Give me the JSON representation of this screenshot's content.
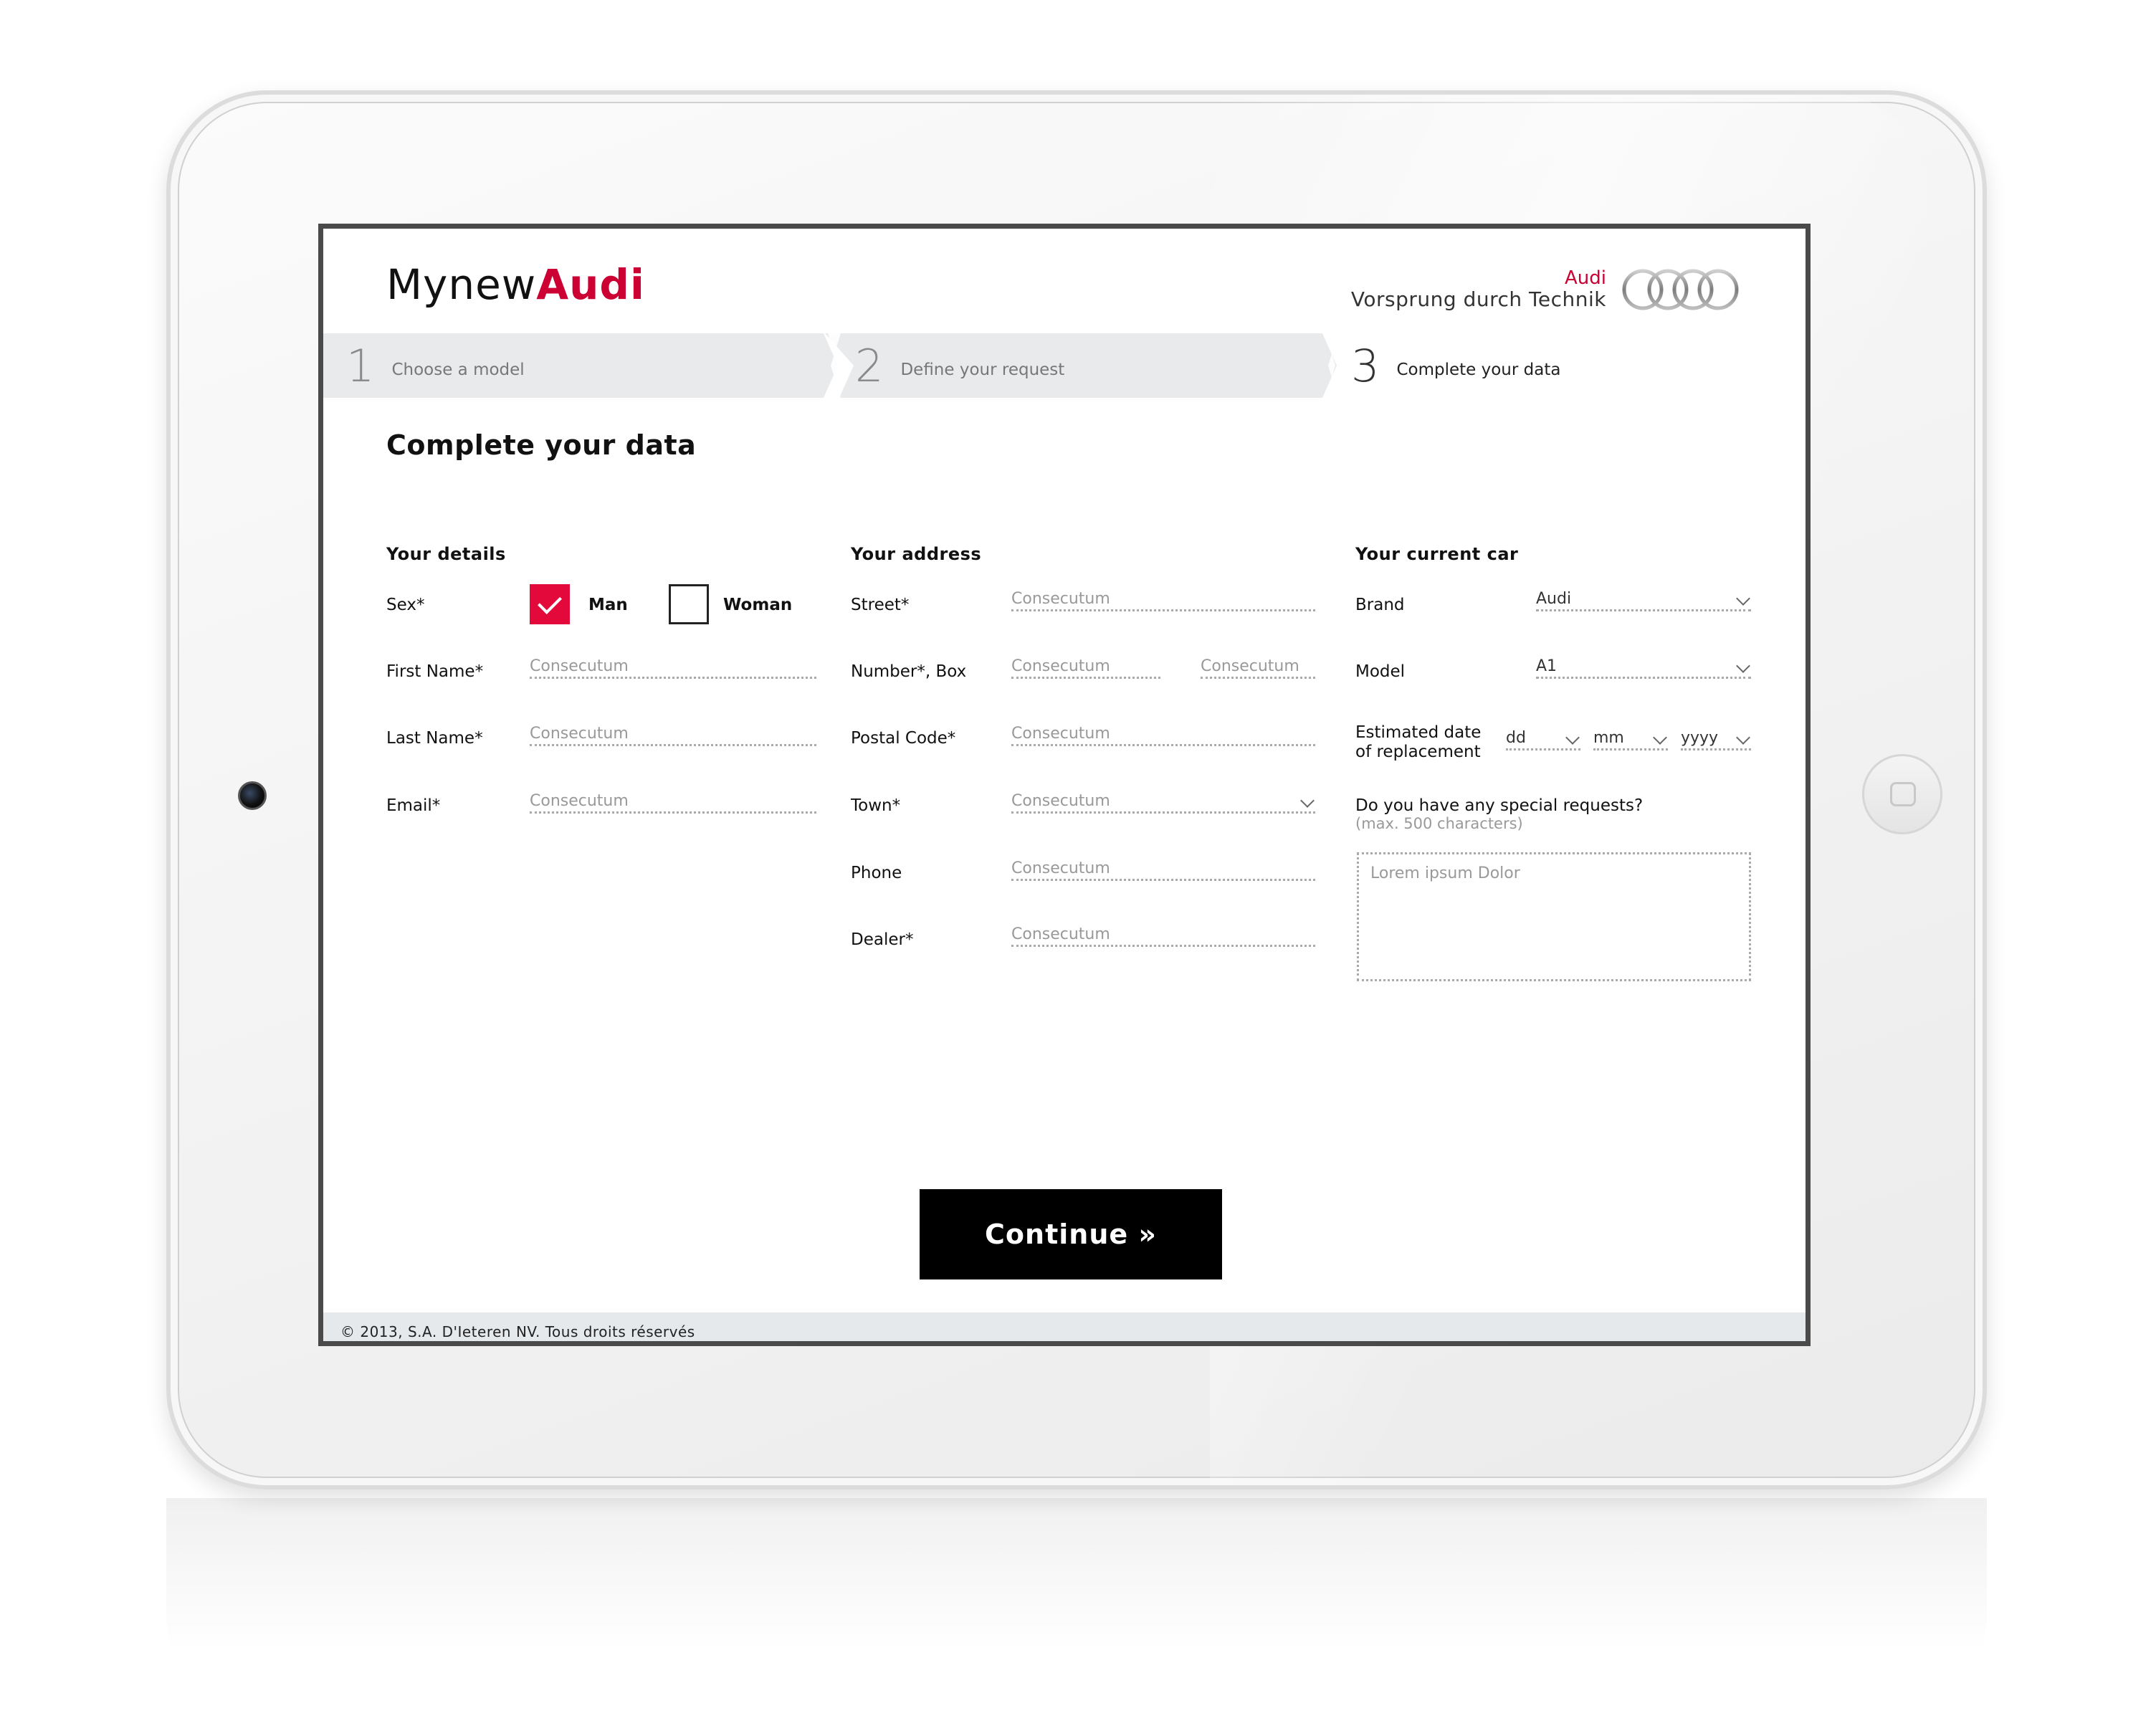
{
  "app": {
    "logo_prefix": "Mynew",
    "logo_brand": "Audi",
    "brand_name": "Audi",
    "brand_slogan": "Vorsprung durch Technik",
    "accent_color": "#cc0033"
  },
  "steps": [
    {
      "number": "1",
      "label": "Choose a model"
    },
    {
      "number": "2",
      "label": "Define your request"
    },
    {
      "number": "3",
      "label": "Complete your data"
    }
  ],
  "page_title": "Complete your data",
  "details": {
    "title": "Your details",
    "sex_label": "Sex*",
    "man_label": "Man",
    "woman_label": "Woman",
    "man_checked": true,
    "woman_checked": false,
    "first_name_label": "First Name*",
    "first_name_placeholder": "Consecutum",
    "last_name_label": "Last Name*",
    "last_name_placeholder": "Consecutum",
    "email_label": "Email*",
    "email_placeholder": "Consecutum"
  },
  "address": {
    "title": "Your address",
    "street_label": "Street*",
    "street_placeholder": "Consecutum",
    "number_label": "Number*, Box",
    "number_placeholder": "Consecutum",
    "box_placeholder": "Consecutum",
    "postal_label": "Postal Code*",
    "postal_placeholder": "Consecutum",
    "town_label": "Town*",
    "town_placeholder": "Consecutum",
    "phone_label": "Phone",
    "phone_placeholder": "Consecutum",
    "dealer_label": "Dealer*",
    "dealer_placeholder": "Consecutum"
  },
  "car": {
    "title": "Your current car",
    "brand_label": "Brand",
    "brand_value": "Audi",
    "model_label": "Model",
    "model_value": "A1",
    "date_label_line1": "Estimated date",
    "date_label_line2": "of replacement",
    "day_value": "dd",
    "month_value": "mm",
    "year_value": "yyyy",
    "requests_label": "Do you have any special requests?",
    "requests_hint": "(max. 500 characters)",
    "requests_placeholder": "Lorem ipsum Dolor"
  },
  "continue_label": "Continue »",
  "footer_text": "© 2013, S.A. D'Ieteren NV. Tous droits réservés"
}
